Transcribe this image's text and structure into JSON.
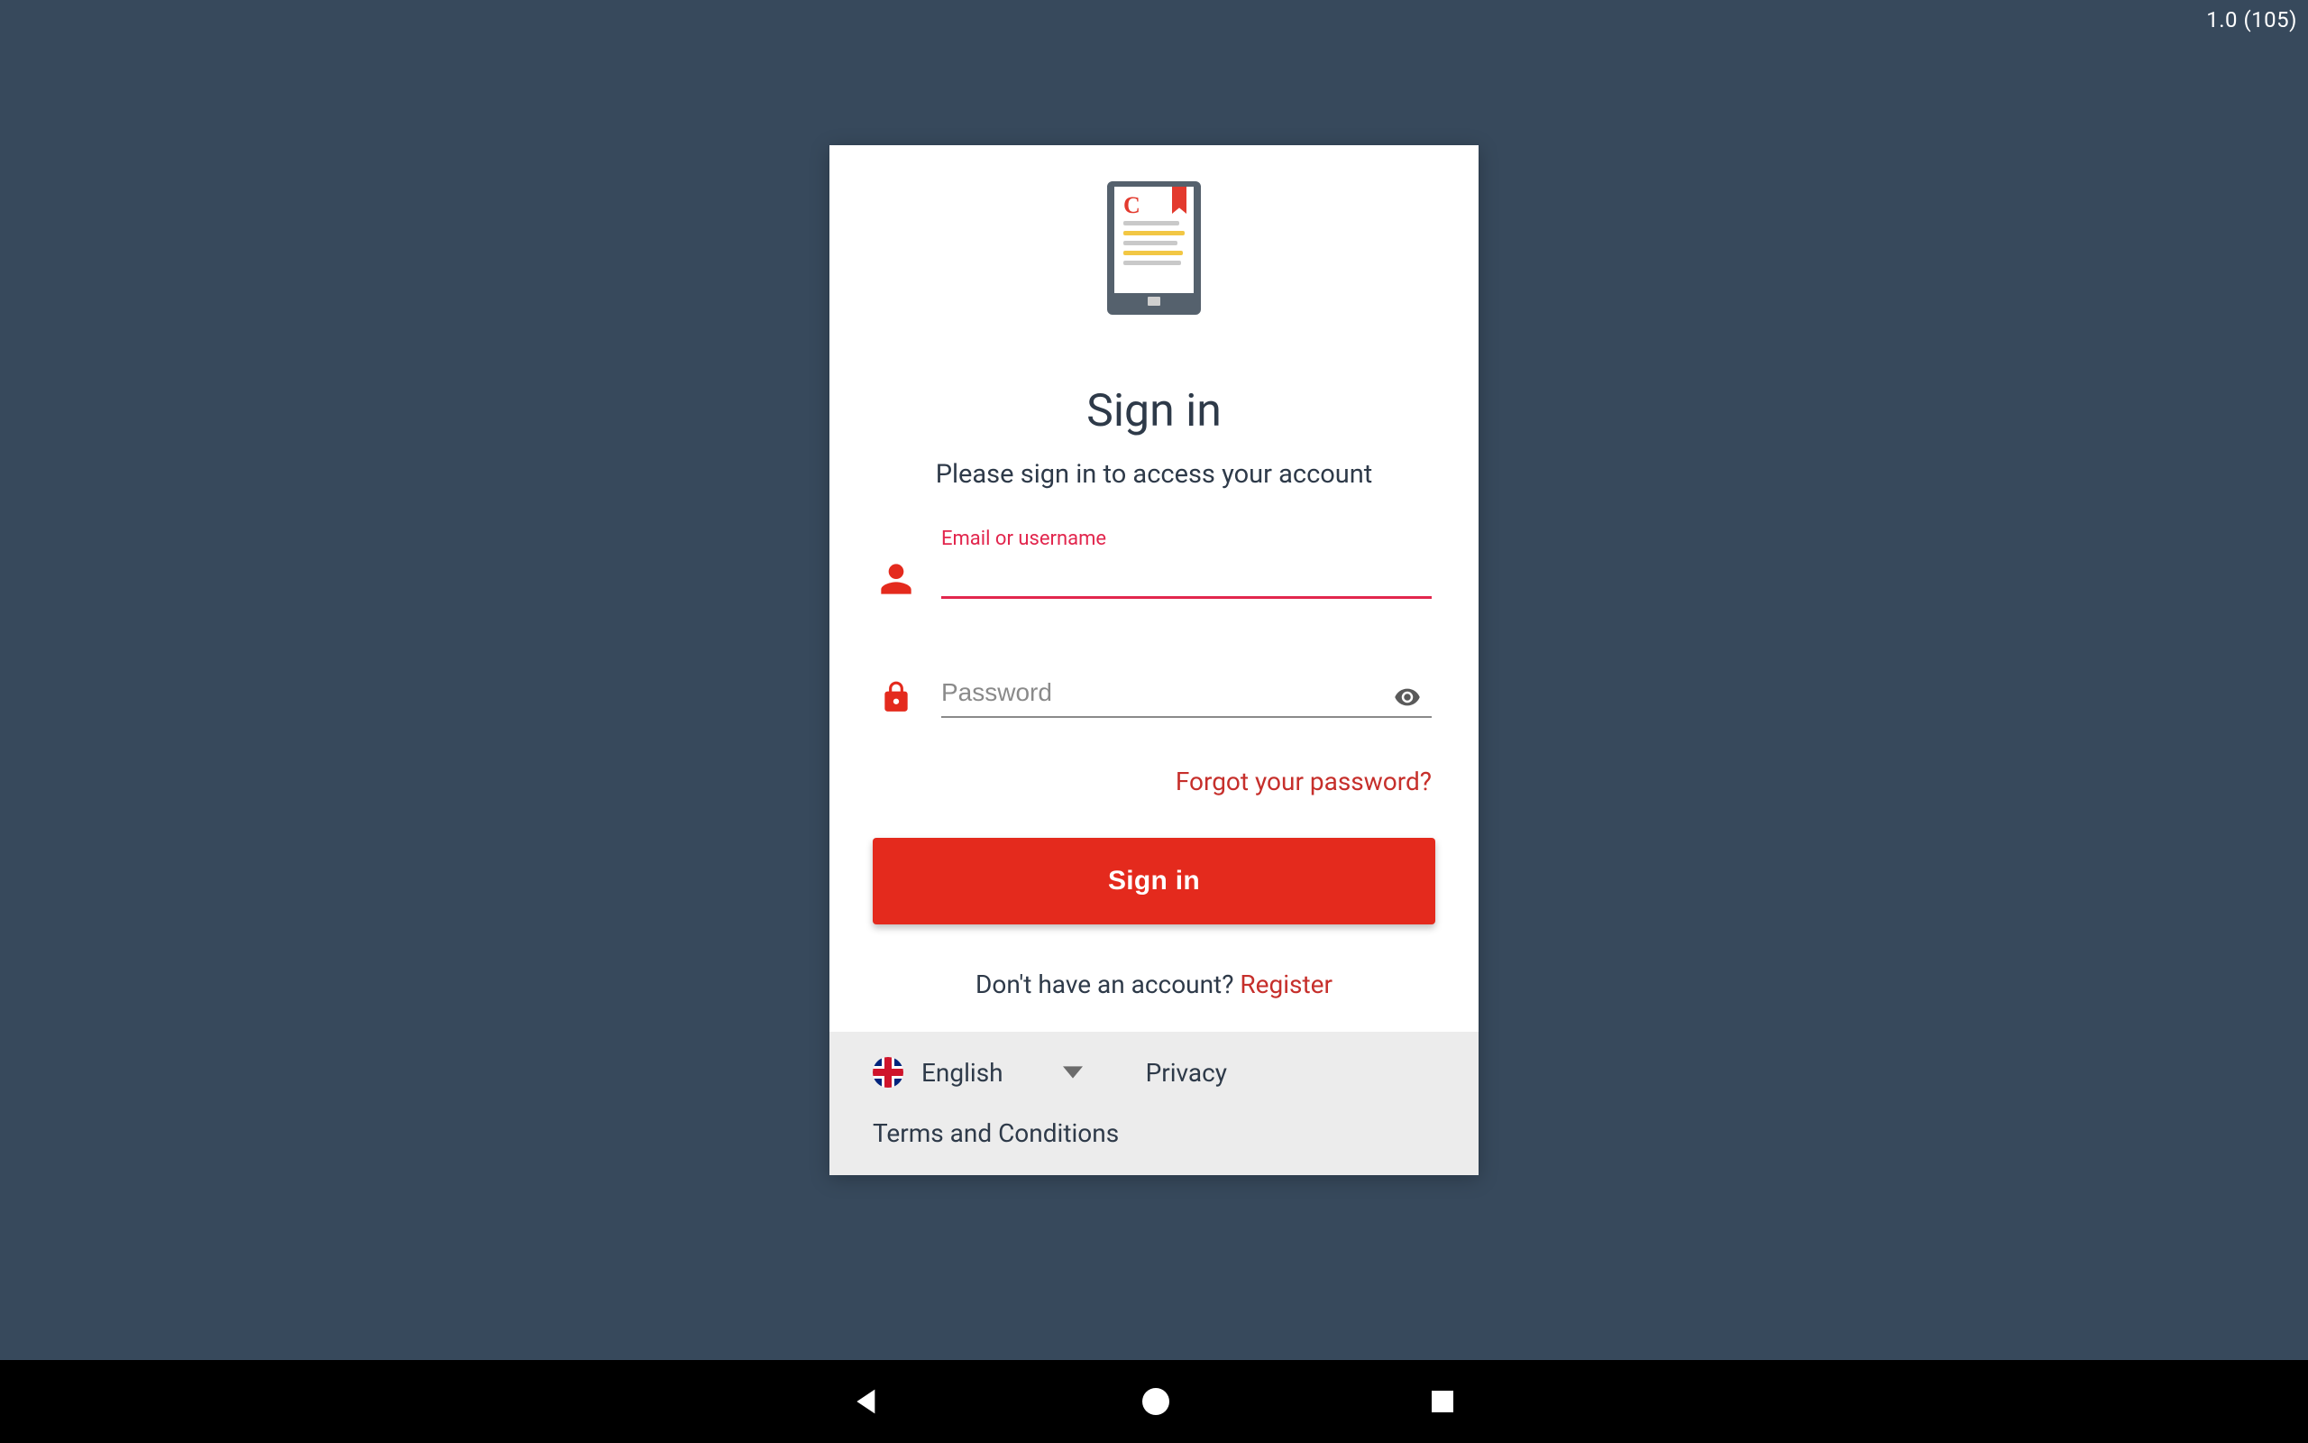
{
  "version_label": "1.0 (105)",
  "signin": {
    "title": "Sign in",
    "subtitle": "Please sign in to access your account",
    "email_label": "Email or username",
    "email_value": "",
    "password_placeholder": "Password",
    "password_value": "",
    "forgot_link": "Forgot your password?",
    "button_label": "Sign in",
    "noacct_text": "Don't have an account? ",
    "register_link": "Register"
  },
  "footer": {
    "language_selected": "English",
    "privacy_link": "Privacy",
    "terms_link": "Terms and Conditions"
  },
  "colors": {
    "background": "#37495c",
    "accent_red": "#e42a1d",
    "accent_pink": "#e2264d",
    "text_dark": "#2e3a49"
  }
}
